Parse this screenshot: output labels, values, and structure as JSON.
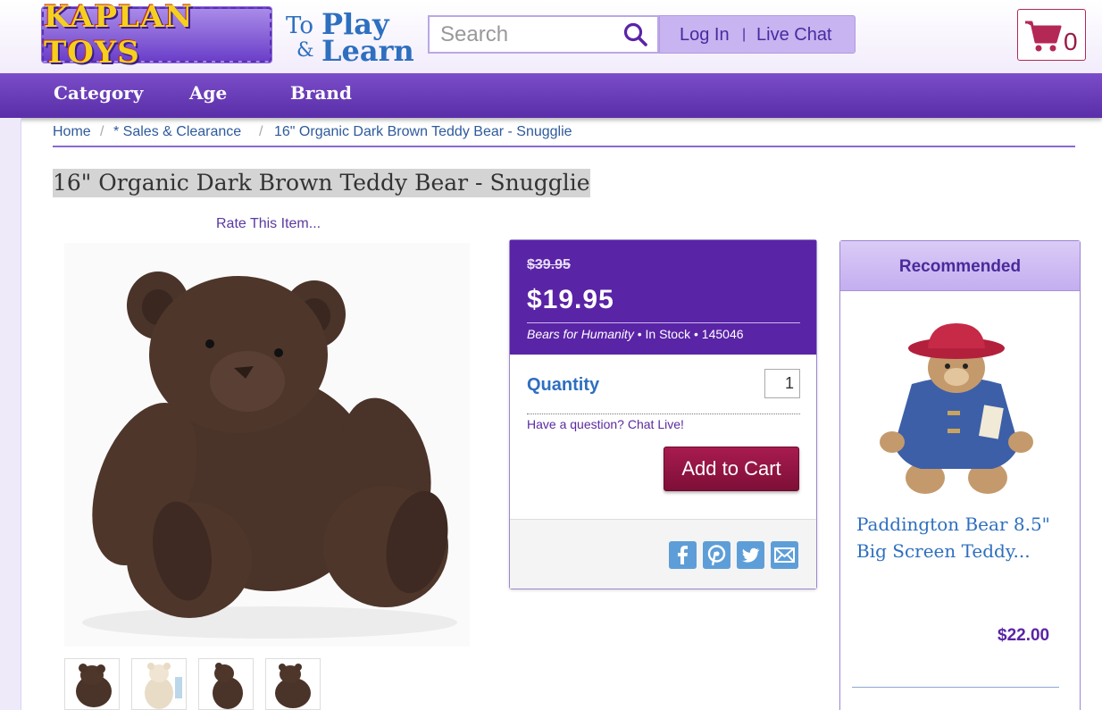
{
  "header": {
    "logo_text": "KAPLAN TOYS",
    "tagline": {
      "to": "To",
      "play": "Play",
      "and": "&",
      "learn": "Learn"
    },
    "search": {
      "placeholder": "Search"
    },
    "login_label": "Log In",
    "separator": "|",
    "live_chat_label": "Live Chat",
    "cart_count": "0"
  },
  "nav": {
    "items": [
      "Category",
      "Age",
      "Brand"
    ]
  },
  "breadcrumb": {
    "items": [
      "Home",
      "* Sales & Clearance",
      "16\" Organic Dark Brown Teddy Bear - Snugglie"
    ],
    "separator": "/"
  },
  "product": {
    "title": "16\" Organic Dark Brown Teddy Bear - Snugglie",
    "rate_label": "Rate This Item...",
    "old_price": "$39.95",
    "price": "$19.95",
    "brand": "Bears for Humanity",
    "stock": "In Stock",
    "sku": "145046",
    "bullet": "•",
    "quantity_label": "Quantity",
    "quantity_value": "1",
    "chat_question": "Have a question? Chat Live!",
    "add_to_cart_label": "Add to Cart",
    "thumbnails": [
      "bear-thumb-1",
      "bear-thumb-2",
      "bear-thumb-3",
      "bear-thumb-4"
    ]
  },
  "share_icons": [
    "facebook-icon",
    "pinterest-icon",
    "twitter-icon",
    "email-icon"
  ],
  "recommended": {
    "title": "Recommended",
    "item_name": "Paddington Bear 8.5\" Big Screen Teddy...",
    "item_price": "$22.00"
  },
  "colors": {
    "brand_purple": "#5a24a6",
    "nav_purple": "#6a3bb8",
    "link_blue": "#2e6fbf",
    "cart_red": "#9a1a45"
  }
}
